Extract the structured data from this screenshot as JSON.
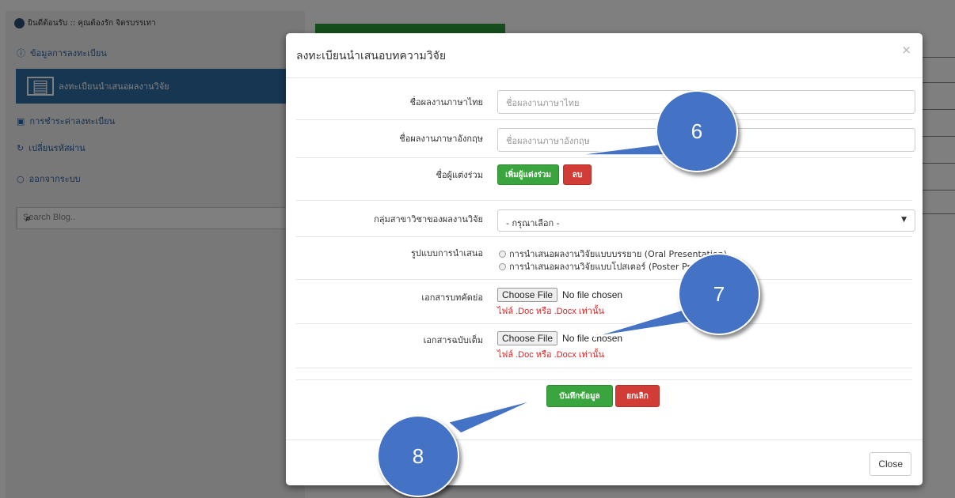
{
  "sidebar": {
    "welcome": "ยินดีต้อนรับ :: คุณต้องรัก จิตรบรรเทา",
    "items": [
      {
        "label": "ข้อมูลการลงทะเบียน"
      },
      {
        "label": "ลงทะเบียนนำเสนอผลงานวิจัย"
      },
      {
        "label": "การชำระค่าลงทะเบียน"
      },
      {
        "label": "เปลี่ยนรหัสผ่าน"
      },
      {
        "label": "ออกจากระบบ"
      }
    ],
    "search_placeholder": "Search Blog.."
  },
  "modal": {
    "title": "ลงทะเบียนนำเสนอบทความวิจัย",
    "close_x": "×",
    "fields": {
      "thai_title": {
        "label": "ชื่อผลงานภาษาไทย",
        "placeholder": "ชื่อผลงานภาษาไทย"
      },
      "english_title": {
        "label": "ชื่อผลงานภาษาอังกฤษ",
        "placeholder": "ชื่อผลงานภาษาอังกฤษ"
      },
      "coauthors": {
        "label": "ชื่อผู้แต่งร่วม",
        "add_label": "เพิ่มผู้แต่งร่วม",
        "delete_label": "ลบ"
      },
      "group": {
        "label": "กลุ่มสาขาวิชาของผลงานวิจัย",
        "value": "- กรุณาเลือก -"
      },
      "format": {
        "label": "รูปแบบการนำเสนอ",
        "options": [
          "การนำเสนอผลงานวิจัยแบบบรรยาย (Oral Presentation)",
          "การนำเสนอผลงานวิจัยแบบโปสเตอร์ (Poster Presentation)"
        ]
      },
      "abstract": {
        "label": "เอกสารบทคัดย่อ",
        "button": "Choose File",
        "status": "No file chosen",
        "hint": "ไฟล์ .Doc หรือ .Docx เท่านั้น"
      },
      "fullpaper": {
        "label": "เอกสารฉบับเต็ม",
        "button": "Choose File",
        "status": "No file chosen",
        "hint": "ไฟล์ .Doc หรือ .Docx เท่านั้น"
      }
    },
    "save_label": "บันทึกข้อมูล",
    "cancel_label": "ยกเลิก",
    "close_label": "Close"
  },
  "callouts": [
    "6",
    "7",
    "8"
  ],
  "colors": {
    "callout": "#4472c4",
    "primary": "#2e6da4",
    "success": "#3aa43e",
    "danger": "#d23c37",
    "hint": "#e02020"
  }
}
